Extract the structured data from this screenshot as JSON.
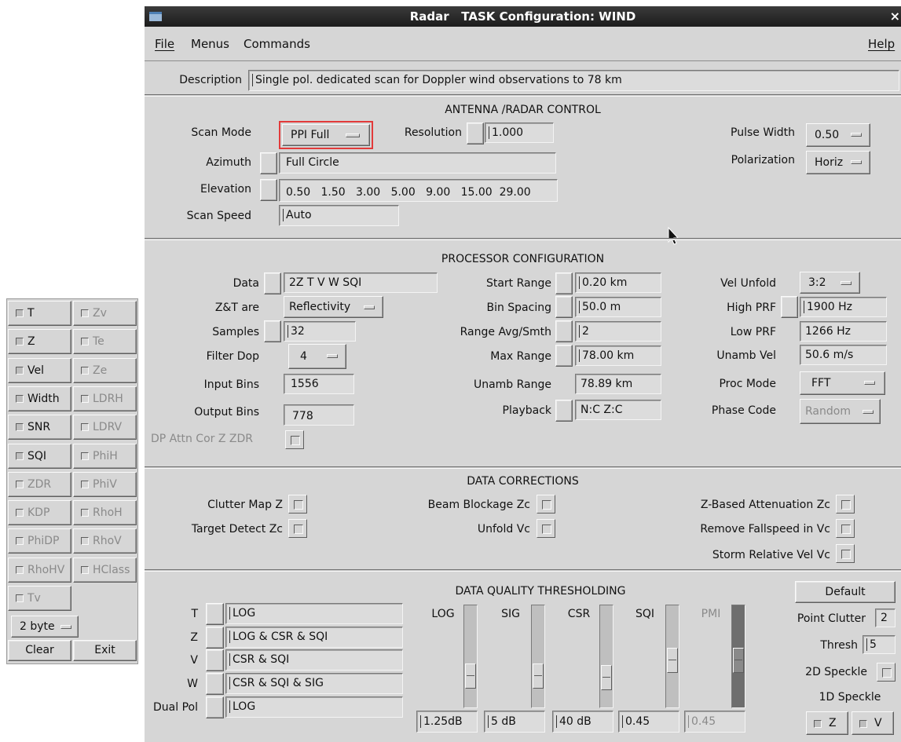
{
  "window": {
    "title": "Radar   TASK Configuration: WIND",
    "close_glyph": "×"
  },
  "menubar": {
    "file": "File",
    "menus": "Menus",
    "commands": "Commands",
    "help": "Help"
  },
  "description": {
    "label": "Description",
    "value": "Single pol. dedicated scan for Doppler wind observations to 78 km"
  },
  "antenna": {
    "heading": "ANTENNA /RADAR CONTROL",
    "scan_mode_label": "Scan Mode",
    "scan_mode": "PPI Full",
    "resolution_label": "Resolution",
    "resolution": "1.000",
    "azimuth_label": "Azimuth",
    "azimuth": "Full Circle",
    "elevation_label": "Elevation",
    "elevation": "0.50   1.50   3.00   5.00   9.00   15.00  29.00",
    "scan_speed_label": "Scan Speed",
    "scan_speed": "Auto",
    "pulse_width_label": "Pulse Width",
    "pulse_width": "0.50",
    "polarization_label": "Polarization",
    "polarization": "Horiz"
  },
  "processor": {
    "heading": "PROCESSOR CONFIGURATION",
    "data_label": "Data",
    "data": "2Z T V W SQI",
    "zt_label": "Z&T are",
    "zt": "Reflectivity",
    "samples_label": "Samples",
    "samples": "32",
    "filter_label": "Filter Dop",
    "filter": "4",
    "input_bins_label": "Input Bins",
    "input_bins": "1556",
    "output_bins_label": "Output Bins",
    "output_bins": "778",
    "dp_attn_label": "DP Attn Cor Z ZDR",
    "start_range_label": "Start Range",
    "start_range": "0.20 km",
    "bin_spacing_label": "Bin Spacing",
    "bin_spacing": "50.0 m",
    "range_avg_label": "Range Avg/Smth",
    "range_avg": "2",
    "max_range_label": "Max Range",
    "max_range": "78.00 km",
    "unamb_range_label": "Unamb Range",
    "unamb_range": "78.89 km",
    "playback_label": "Playback",
    "playback": "N:C Z:C",
    "vel_unfold_label": "Vel Unfold",
    "vel_unfold": "3:2",
    "high_prf_label": "High PRF",
    "high_prf": "1900 Hz",
    "low_prf_label": "Low PRF",
    "low_prf": "1266 Hz",
    "unamb_vel_label": "Unamb Vel",
    "unamb_vel": "50.6 m/s",
    "proc_mode_label": "Proc Mode",
    "proc_mode": "FFT",
    "phase_code_label": "Phase Code",
    "phase_code": "Random"
  },
  "corrections": {
    "heading": "DATA CORRECTIONS",
    "clutter_map": "Clutter Map Z",
    "target_detect": "Target Detect Zc",
    "beam_blockage": "Beam Blockage Zc",
    "unfold_vc": "Unfold Vc",
    "z_atten": "Z-Based Attenuation Zc",
    "fallspeed": "Remove Fallspeed in Vc",
    "storm_rel": "Storm Relative Vel Vc"
  },
  "thresholding": {
    "heading": "DATA QUALITY THRESHOLDING",
    "rows": [
      {
        "label": "T",
        "value": "LOG"
      },
      {
        "label": "Z",
        "value": "LOG & CSR & SQI"
      },
      {
        "label": "V",
        "value": "CSR & SQI"
      },
      {
        "label": "W",
        "value": "CSR & SQI & SIG"
      },
      {
        "label": "Dual Pol",
        "value": "LOG"
      }
    ],
    "sliders": [
      {
        "label": "LOG",
        "value": "1.25dB",
        "level": 0.25
      },
      {
        "label": "SIG",
        "value": "5 dB",
        "level": 0.25
      },
      {
        "label": "CSR",
        "value": "40 dB",
        "level": 0.22
      },
      {
        "label": "SQI",
        "value": "0.45",
        "level": 0.45
      },
      {
        "label": "PMI",
        "value": "0.45",
        "level": 0.45,
        "disabled": true
      }
    ],
    "default_button": "Default",
    "point_clutter_label": "Point Clutter",
    "point_clutter": "2",
    "thresh_label": "Thresh",
    "thresh": "5",
    "speckle2d_label": "2D Speckle",
    "speckle1d_label": "1D Speckle",
    "speckle_z": "Z",
    "speckle_v": "V"
  },
  "side_panel": {
    "left": [
      "T",
      "Z",
      "Vel",
      "Width",
      "SNR",
      "SQI",
      "ZDR",
      "KDP",
      "PhiDP",
      "RhoHV",
      "Tv"
    ],
    "right": [
      "Zv",
      "Te",
      "Ze",
      "LDRH",
      "LDRV",
      "PhiH",
      "PhiV",
      "RhoH",
      "RhoV",
      "HClass"
    ],
    "byte_option": "2 byte",
    "clear": "Clear",
    "exit": "Exit"
  }
}
